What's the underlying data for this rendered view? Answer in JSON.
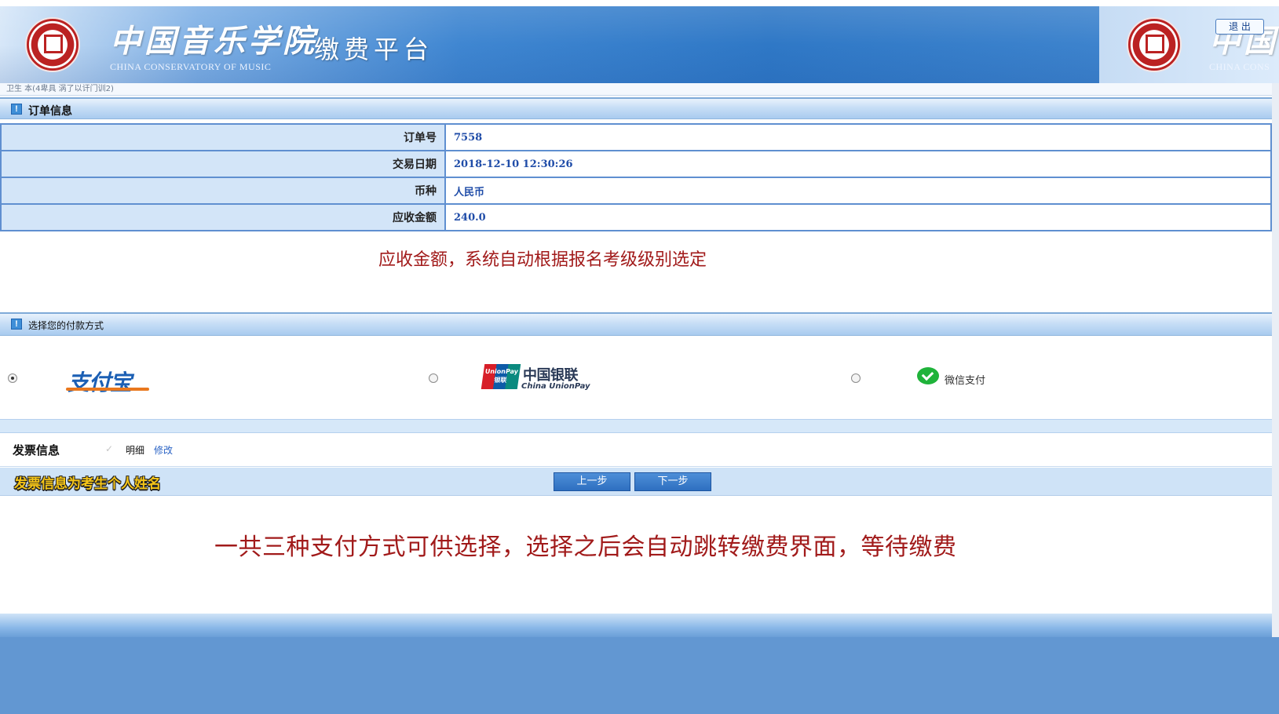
{
  "header": {
    "school_name_cn": "中国音乐学院",
    "school_name_en": "CHINA CONSERVATORY OF MUSIC",
    "platform_title": "缴费平台",
    "school_name_cn_partial": "中国",
    "school_name_en_partial": "CHINA CONS",
    "logout_label": "退 出",
    "colors": {
      "banner": "#2f78c6",
      "banner_light": "#d7e7f8"
    }
  },
  "breadcrumb": {
    "text": "卫生 本(4卑具  涡了以讦门训2)"
  },
  "order_section": {
    "title": "订单信息",
    "rows": [
      {
        "label": "订单号",
        "value": "7558"
      },
      {
        "label": "交易日期",
        "value": "2018-12-10 12:30:26"
      },
      {
        "label": "币种",
        "value": "人民币"
      },
      {
        "label": "应收金额",
        "value": "240.0"
      }
    ]
  },
  "annotation_amount": "应收金额，系统自动根据报名考级级别选定",
  "payment_section": {
    "title": "选择您的付款方式",
    "options": [
      {
        "name": "alipay",
        "logo_text": "支付宝",
        "selected": true
      },
      {
        "name": "unionpay",
        "logo_text": "中国银联",
        "logo_sub": "China UnionPay",
        "badge": "UnionPay 银联",
        "selected": false
      },
      {
        "name": "wechat",
        "label": "微信支付",
        "selected": false
      }
    ]
  },
  "invoice": {
    "label": "发票信息",
    "checkmark": "✓",
    "detail": "明细",
    "edit_link": "修改"
  },
  "actions": {
    "invoice_note": "发票信息为考生个人姓名",
    "prev_label": "上一步",
    "next_label": "下一步"
  },
  "annotation_payment": "一共三种支付方式可供选择，选择之后会自动跳转缴费界面，等待缴费",
  "colors": {
    "annotation_red": "#a11a1a",
    "table_border": "#5f8fd0",
    "label_bg": "#d3e5f8",
    "value_text": "#1f4ca8",
    "button": "#2e6fc0",
    "footer": "#6297d2"
  }
}
